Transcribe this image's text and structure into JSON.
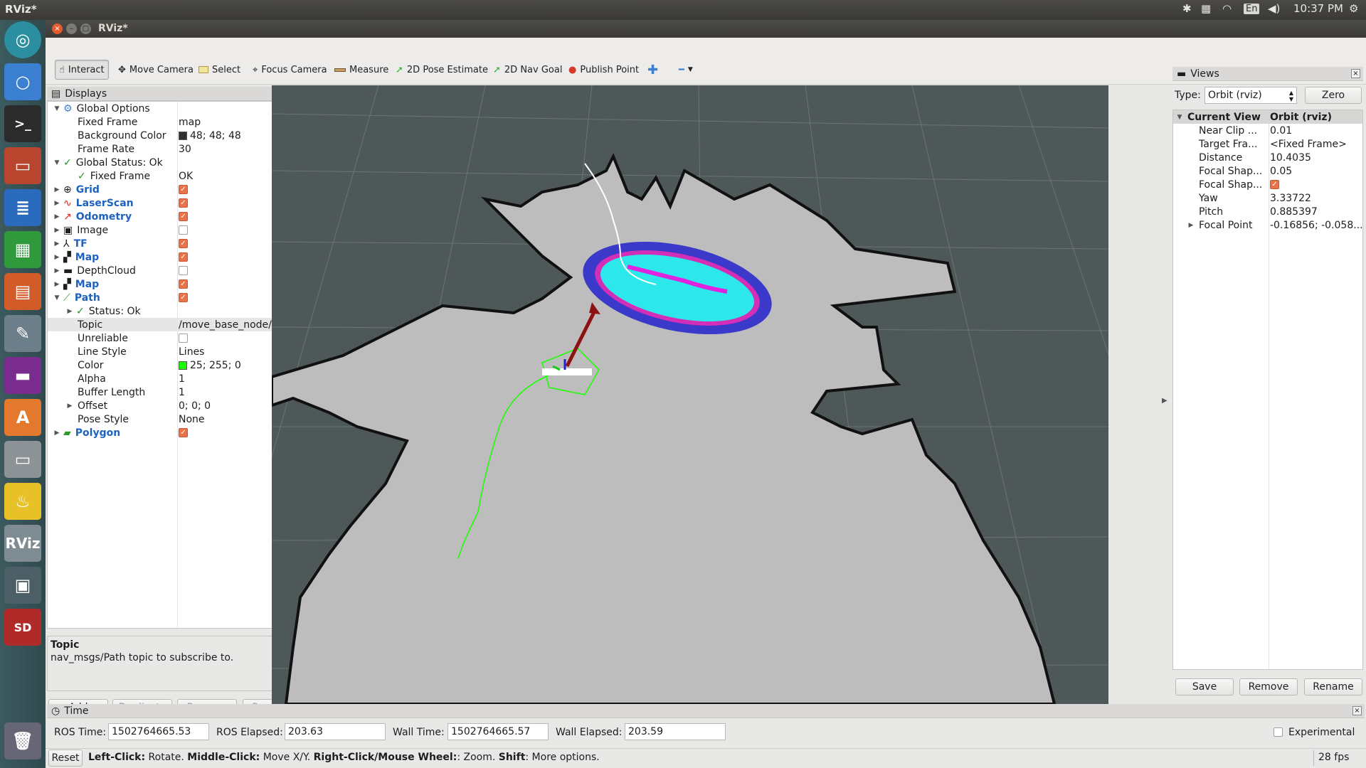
{
  "topbar": {
    "app_name": "RViz*",
    "lang": "En",
    "time": "10:37 PM"
  },
  "window": {
    "title": "RViz*"
  },
  "toolbar": {
    "tools": [
      {
        "label": "Interact",
        "icon": "cursor-icon"
      },
      {
        "label": "Move Camera",
        "icon": "move-camera-icon"
      },
      {
        "label": "Select",
        "icon": "select-box-icon"
      },
      {
        "label": "Focus Camera",
        "icon": "focus-camera-icon"
      },
      {
        "label": "Measure",
        "icon": "ruler-icon"
      },
      {
        "label": "2D Pose Estimate",
        "icon": "pose-arrow-icon"
      },
      {
        "label": "2D Nav Goal",
        "icon": "nav-goal-arrow-icon"
      },
      {
        "label": "Publish Point",
        "icon": "map-pin-icon"
      }
    ]
  },
  "displays": {
    "title": "Displays",
    "global_options": "Global Options",
    "fixed_frame_label": "Fixed Frame",
    "fixed_frame_value": "map",
    "background_color_label": "Background Color",
    "background_color_value": "48; 48; 48",
    "frame_rate_label": "Frame Rate",
    "frame_rate_value": "30",
    "global_status": "Global Status: Ok",
    "global_status_fixed_frame": "Fixed Frame",
    "global_status_fixed_frame_value": "OK",
    "items": [
      {
        "label": "Grid",
        "checked": true
      },
      {
        "label": "LaserScan",
        "checked": true
      },
      {
        "label": "Odometry",
        "checked": true
      },
      {
        "label": "Image",
        "checked": false
      },
      {
        "label": "TF",
        "checked": true
      },
      {
        "label": "Map",
        "checked": true
      },
      {
        "label": "DepthCloud",
        "checked": false
      },
      {
        "label": "Map",
        "checked": true
      },
      {
        "label": "Path",
        "checked": true
      }
    ],
    "path_status": "Status: Ok",
    "path_props": [
      {
        "label": "Topic",
        "value": "/move_base_node/DW..."
      },
      {
        "label": "Unreliable",
        "value": ""
      },
      {
        "label": "Line Style",
        "value": "Lines"
      },
      {
        "label": "Color",
        "value": "25; 255; 0"
      },
      {
        "label": "Alpha",
        "value": "1"
      },
      {
        "label": "Buffer Length",
        "value": "1"
      },
      {
        "label": "Offset",
        "value": "0; 0; 0"
      },
      {
        "label": "Pose Style",
        "value": "None"
      }
    ],
    "polygon": {
      "label": "Polygon",
      "checked": true
    },
    "help_title": "Topic",
    "help_text": "nav_msgs/Path topic to subscribe to.",
    "buttons": {
      "add": "Add",
      "duplicate": "Duplicate",
      "remove": "Remove",
      "rename": "Rename"
    }
  },
  "views": {
    "title": "Views",
    "type_label": "Type:",
    "type_value": "Orbit (rviz)",
    "zero": "Zero",
    "current_view": "Current View",
    "current_view_type": "Orbit (rviz)",
    "props": [
      {
        "label": "Near Clip ...",
        "value": "0.01"
      },
      {
        "label": "Target Fra...",
        "value": "<Fixed Frame>"
      },
      {
        "label": "Distance",
        "value": "10.4035"
      },
      {
        "label": "Focal Shap...",
        "value": "0.05"
      },
      {
        "label": "Focal Shap...",
        "value": ""
      },
      {
        "label": "Yaw",
        "value": "3.33722"
      },
      {
        "label": "Pitch",
        "value": "0.885397"
      },
      {
        "label": "Focal Point",
        "value": "-0.16856; -0.058..."
      }
    ],
    "buttons": {
      "save": "Save",
      "remove": "Remove",
      "rename": "Rename"
    }
  },
  "time": {
    "title": "Time",
    "ros_time_label": "ROS Time:",
    "ros_time": "1502764665.53",
    "ros_elapsed_label": "ROS Elapsed:",
    "ros_elapsed": "203.63",
    "wall_time_label": "Wall Time:",
    "wall_time": "1502764665.57",
    "wall_elapsed_label": "Wall Elapsed:",
    "wall_elapsed": "203.59",
    "experimental": "Experimental"
  },
  "status": {
    "reset": "Reset",
    "left_click": "Left-Click:",
    "left_action": " Rotate. ",
    "middle_click": "Middle-Click:",
    "middle_action": " Move X/Y. ",
    "right_click": "Right-Click/Mouse Wheel:",
    "right_action": ": Zoom. ",
    "shift": "Shift",
    "shift_action": ": More options.",
    "fps": "28 fps"
  },
  "colors": {
    "accent_check": "#e8734a",
    "path_green": "#19ff00",
    "bg": "#303030"
  }
}
